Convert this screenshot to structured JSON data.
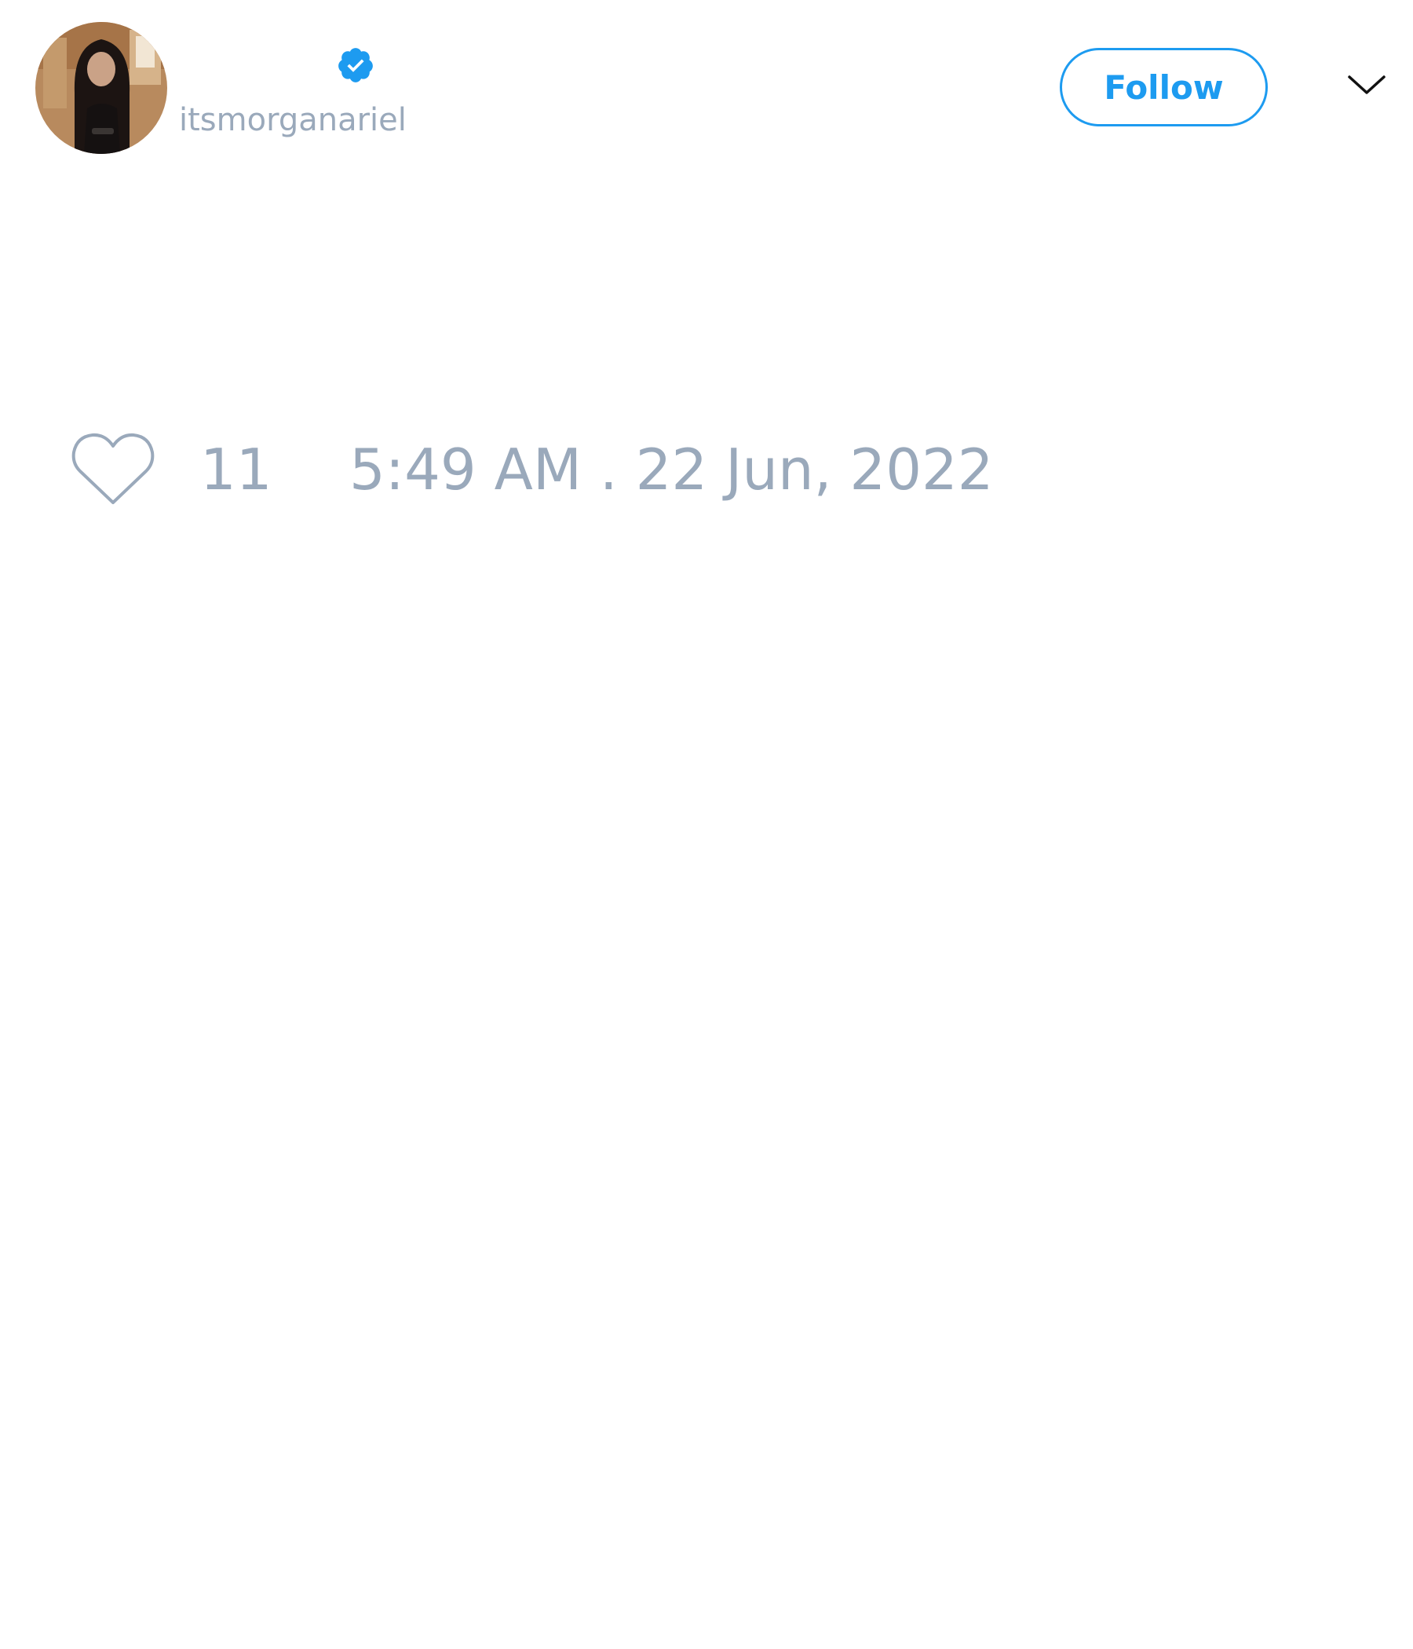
{
  "author": {
    "handle": "itsmorganariel",
    "verified": true,
    "avatar_icon": "profile-photo"
  },
  "actions": {
    "follow_label": "Follow",
    "menu_icon": "chevron-down-icon"
  },
  "footer": {
    "like_icon": "heart-icon",
    "like_count": "11",
    "timestamp": "5:49 AM . 22 Jun, 2022"
  },
  "colors": {
    "accent": "#1d9bf0",
    "muted_text": "#9aa9bb",
    "background": "#ffffff"
  }
}
